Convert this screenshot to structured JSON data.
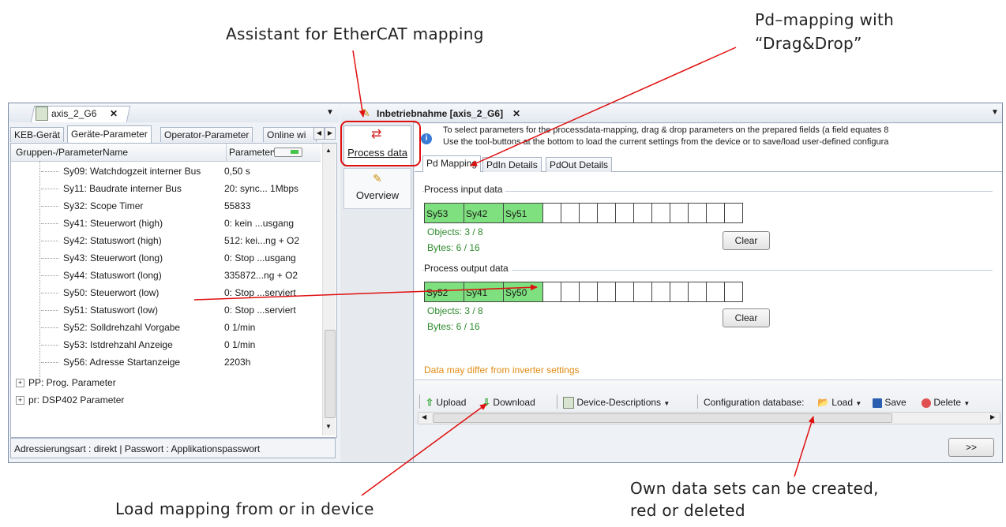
{
  "annotations": {
    "assistant": "Assistant for EtherCAT mapping",
    "pd_mapping_line1": "Pd–mapping with",
    "pd_mapping_line2": "“Drag&Drop”",
    "load_mapping": "Load mapping from or in device",
    "own_data_line1": "Own data sets can be created,",
    "own_data_line2": "red or deleted"
  },
  "left_panel": {
    "doc_tab": "axis_2_G6",
    "close_glyph": "✕",
    "tabs": [
      "KEB-Gerät",
      "Geräte-Parameter",
      "Operator-Parameter",
      "Online wi"
    ],
    "col_name": "Gruppen-/ParameterName",
    "col_value": "Parameterwert",
    "rows": [
      {
        "name": "Sy09: Watchdogzeit interner Bus",
        "value": "0,50 s"
      },
      {
        "name": "Sy11: Baudrate interner Bus",
        "value": "20: sync... 1Mbps"
      },
      {
        "name": "Sy32: Scope Timer",
        "value": "55833"
      },
      {
        "name": "Sy41: Steuerwort (high)",
        "value": "0: kein ...usgang"
      },
      {
        "name": "Sy42: Statuswort (high)",
        "value": "512: kei...ng + O2"
      },
      {
        "name": "Sy43: Steuerwort (long)",
        "value": "0: Stop ...usgang"
      },
      {
        "name": "Sy44: Statuswort (long)",
        "value": "335872...ng + O2"
      },
      {
        "name": "Sy50: Steuerwort (low)",
        "value": "0: Stop ...serviert"
      },
      {
        "name": "Sy51: Statuswort (low)",
        "value": "0: Stop ...serviert"
      },
      {
        "name": "Sy52: Solldrehzahl Vorgabe",
        "value": "0 1/min"
      },
      {
        "name": "Sy53: Istdrehzahl Anzeige",
        "value": "0 1/min"
      },
      {
        "name": "Sy56: Adresse Startanzeige",
        "value": "2203h"
      }
    ],
    "groups": [
      {
        "label": "PP: Prog. Parameter"
      },
      {
        "label": "pr: DSP402 Parameter"
      }
    ],
    "status_bar": "Adressierungsart  : direkt  |  Passwort  : Applikationspasswort"
  },
  "right_panel": {
    "doc_tab": "Inbetriebnahme [axis_2_G6]",
    "close_glyph": "✕",
    "sidebar": {
      "process_data": "Process data",
      "overview": "Overview"
    },
    "info_line1": "To select parameters for the processdata-mapping, drag & drop parameters on the prepared fields (a field equates 8",
    "info_line2": "Use the tool-buttons at the bottom to load the current settings from the device or to save/load user-defined configura",
    "tabs": [
      "Pd Mapping",
      "PdIn Details",
      "PdOut Details"
    ],
    "input_group": {
      "title": "Process input data",
      "cells": [
        "Sy53",
        "Sy42",
        "Sy51"
      ],
      "empty_cells": 10,
      "objects": "Objects: 3 / 8",
      "bytes": "Bytes: 6 / 16",
      "clear": "Clear"
    },
    "output_group": {
      "title": "Process output data",
      "cells": [
        "Sy52",
        "Sy41",
        "Sy50"
      ],
      "empty_cells": 10,
      "objects": "Objects: 3 / 8",
      "bytes": "Bytes: 6 / 16",
      "clear": "Clear"
    },
    "warning": "Data may differ from inverter settings",
    "toolbar": {
      "upload": "Upload",
      "download": "Download",
      "device_descriptions": "Device-Descriptions",
      "config_db": "Configuration database:",
      "load": "Load",
      "save": "Save",
      "delete": "Delete"
    },
    "next_button": ">>"
  },
  "colors": {
    "filled_cell": "#7ee07e",
    "annotation_arrow": "#e01010",
    "info_green": "#2e8b2e",
    "warning_orange": "#e08a12"
  }
}
